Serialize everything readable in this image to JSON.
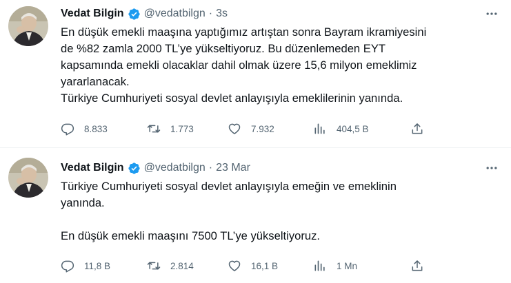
{
  "tweets": [
    {
      "author": "Vedat Bilgin",
      "handle": "@vedatbilgn",
      "separator": "·",
      "time": "3s",
      "text_lines": [
        "En düşük emekli maaşına yaptığımız artıştan sonra Bayram ikramiyesini",
        "de %82 zamla 2000 TL’ye yükseltiyoruz. Bu düzenlemeden EYT",
        "kapsamında emekli olacaklar dahil olmak üzere 15,6 milyon emeklimiz",
        "yararlanacak.",
        "Türkiye Cumhuriyeti sosyal devlet anlayışıyla emeklilerinin yanında."
      ],
      "replies": "8.833",
      "retweets": "1.773",
      "likes": "7.932",
      "views": "404,5 B"
    },
    {
      "author": "Vedat Bilgin",
      "handle": "@vedatbilgn",
      "separator": "·",
      "time": "23 Mar",
      "text_lines": [
        "Türkiye Cumhuriyeti sosyal devlet anlayışıyla emeğin ve emeklinin",
        "yanında.",
        "",
        "En düşük emekli maaşını 7500 TL’ye yükseltiyoruz."
      ],
      "replies": "11,8 B",
      "retweets": "2.814",
      "likes": "16,1 B",
      "views": "1 Mn"
    }
  ],
  "colors": {
    "text": "#0f1419",
    "muted": "#536471",
    "verified": "#1d9bf0",
    "divider": "#eff3f4"
  },
  "icons": {
    "verified": "verified-badge-icon",
    "more": "more-dots-icon",
    "reply": "reply-icon",
    "retweet": "retweet-icon",
    "like": "heart-icon",
    "views": "views-chart-icon",
    "share": "share-icon"
  }
}
